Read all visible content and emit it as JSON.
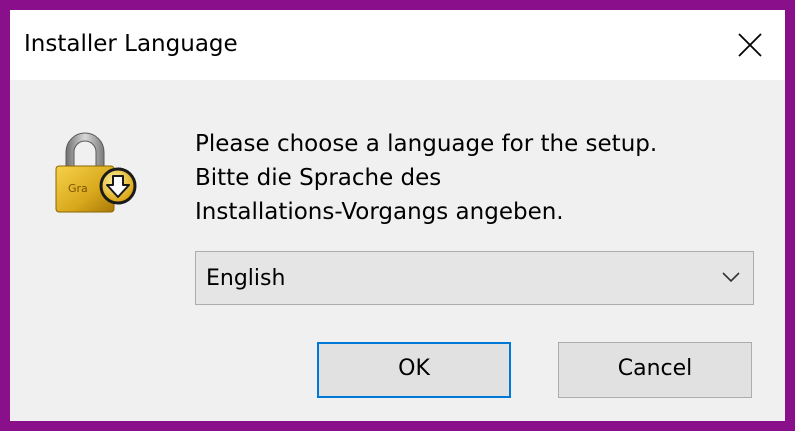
{
  "window": {
    "title": "Installer Language"
  },
  "icons": {
    "close": "close-icon",
    "lock": "padlock-download-icon",
    "chevron": "chevron-down-icon"
  },
  "message": {
    "lines": [
      "Please choose a language for the setup.",
      "Bitte die Sprache des",
      "Installations-Vorgangs angeben."
    ]
  },
  "language_select": {
    "selected": "English"
  },
  "buttons": {
    "ok_label": "OK",
    "cancel_label": "Cancel"
  },
  "colors": {
    "background_border": "#8a0f8a",
    "window_body": "#f0f0f0",
    "focus_accent": "#0078d7"
  }
}
